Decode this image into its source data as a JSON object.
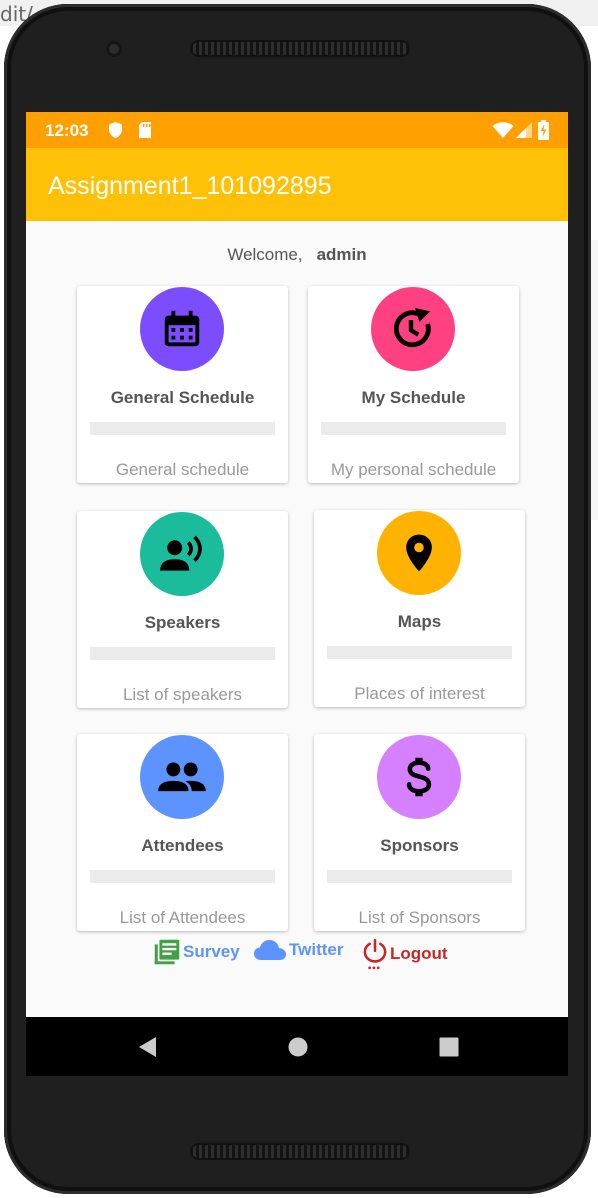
{
  "background": {
    "window_text": "dit/"
  },
  "status_bar": {
    "time": "12:03"
  },
  "app_bar": {
    "title": "Assignment1_101092895"
  },
  "welcome": {
    "label": "Welcome,",
    "username": "admin"
  },
  "cards": [
    {
      "title": "General Schedule",
      "subtitle": "General schedule",
      "icon": "calendar-icon",
      "color": "#7c4dff"
    },
    {
      "title": "My Schedule",
      "subtitle": "My personal schedule",
      "icon": "schedule-history-icon",
      "color": "#ff4081"
    },
    {
      "title": "Speakers",
      "subtitle": "List of speakers",
      "icon": "speaker-icon",
      "color": "#1abc9c"
    },
    {
      "title": "Maps",
      "subtitle": "Places of interest",
      "icon": "map-pin-icon",
      "color": "#ffb300"
    },
    {
      "title": "Attendees",
      "subtitle": "List of Attendees",
      "icon": "people-icon",
      "color": "#5c93ff"
    },
    {
      "title": "Sponsors",
      "subtitle": "List of Sponsors",
      "icon": "dollar-icon",
      "color": "#d580ff"
    }
  ],
  "links": {
    "survey": {
      "label": "Survey",
      "color": "#43a047",
      "icon": "list-icon"
    },
    "twitter": {
      "label": "Twitter",
      "color": "#5c93ff",
      "icon": "cloud-icon"
    },
    "logout": {
      "label": "Logout",
      "color": "#c62828",
      "icon": "power-icon"
    }
  },
  "colors": {
    "status_bar": "#ffa000",
    "app_bar": "#ffc107"
  }
}
